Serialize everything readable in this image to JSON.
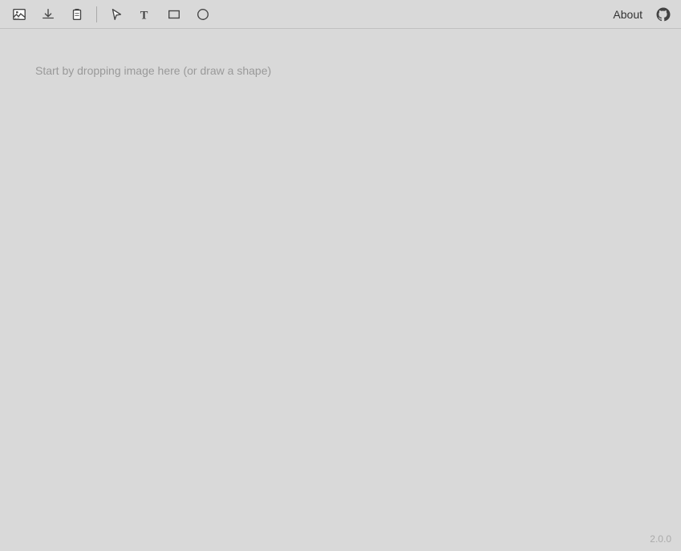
{
  "toolbar": {
    "tools": [
      {
        "name": "image-tool",
        "label": "Image"
      },
      {
        "name": "download-tool",
        "label": "Download"
      },
      {
        "name": "clipboard-tool",
        "label": "Clipboard"
      },
      {
        "name": "select-tool",
        "label": "Select"
      },
      {
        "name": "text-tool",
        "label": "Text"
      },
      {
        "name": "rectangle-tool",
        "label": "Rectangle"
      },
      {
        "name": "ellipse-tool",
        "label": "Ellipse"
      }
    ],
    "about_label": "About"
  },
  "canvas": {
    "drop_hint": "Start by dropping image here (or draw a shape)"
  },
  "footer": {
    "version": "2.0.0"
  }
}
